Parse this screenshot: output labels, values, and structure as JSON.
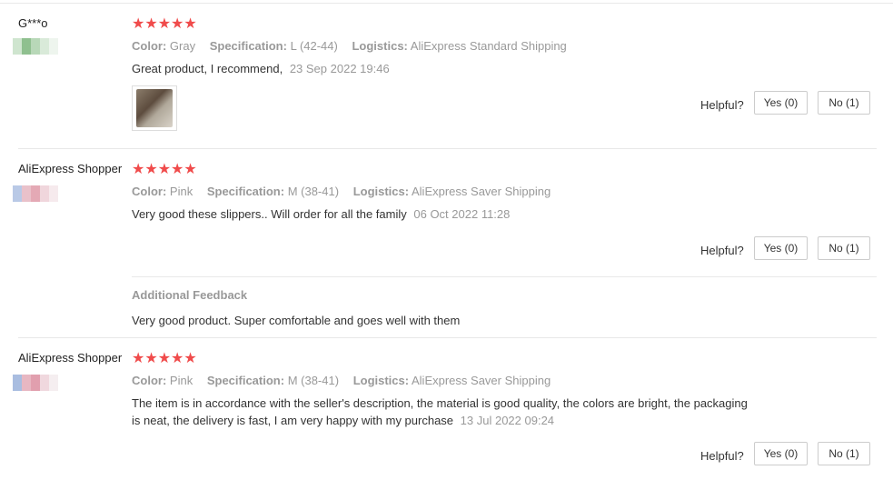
{
  "reviews": [
    {
      "user": "G***o",
      "stars": "★★★★★",
      "color_label": "Color:",
      "color": "Gray",
      "spec_label": "Specification:",
      "spec": "L (42-44)",
      "logistics_label": "Logistics:",
      "logistics": "AliExpress Standard Shipping",
      "text": "Great product, I recommend,",
      "date": "23 Sep 2022 19:46",
      "helpful_label": "Helpful?",
      "yes_label": "Yes (0)",
      "no_label": "No (1)"
    },
    {
      "user": "AliExpress Shopper",
      "stars": "★★★★★",
      "color_label": "Color:",
      "color": "Pink",
      "spec_label": "Specification:",
      "spec": "M (38-41)",
      "logistics_label": "Logistics:",
      "logistics": "AliExpress Saver Shipping",
      "text": "Very good these slippers.. Will order for all the family",
      "date": "06 Oct 2022 11:28",
      "helpful_label": "Helpful?",
      "yes_label": "Yes (0)",
      "no_label": "No (1)",
      "additional_title": "Additional Feedback",
      "additional_text": "Very good product. Super comfortable and goes well with them"
    },
    {
      "user": "AliExpress Shopper",
      "stars": "★★★★★",
      "color_label": "Color:",
      "color": "Pink",
      "spec_label": "Specification:",
      "spec": "M (38-41)",
      "logistics_label": "Logistics:",
      "logistics": "AliExpress Saver Shipping",
      "text_line1": "The item is in accordance with the seller's description, the material is good quality, the colors are bright, the packaging",
      "text_line2": "is neat, the delivery is fast, I am very happy with my purchase",
      "date": "13 Jul 2022 09:24",
      "helpful_label": "Helpful?",
      "yes_label": "Yes (0)",
      "no_label": "No (1)"
    }
  ],
  "colors": {
    "star": "#f04b4b",
    "muted": "#999999",
    "border": "#cccccc"
  }
}
